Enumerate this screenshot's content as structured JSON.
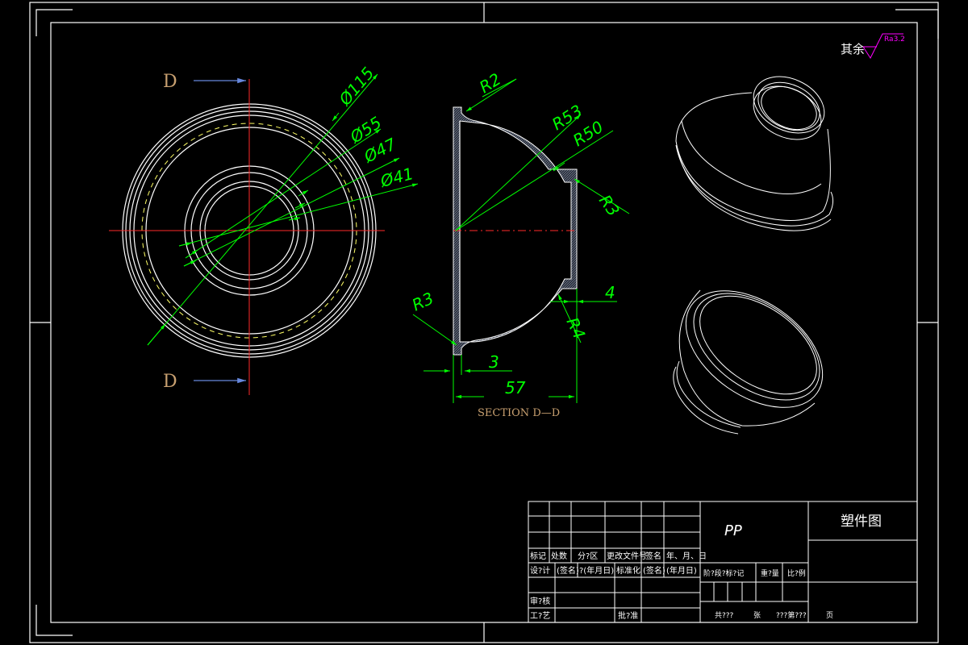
{
  "drawing": {
    "section_marker": "D",
    "section_title": "SECTION D—D",
    "roughness": {
      "text": "其余",
      "value": "Ra3.2"
    },
    "front_view_dims": [
      "Ø115",
      "Ø55",
      "Ø47",
      "Ø41"
    ],
    "section_dims": [
      "R2",
      "R53",
      "R50",
      "R3",
      "R3",
      "R4",
      "4",
      "3",
      "57"
    ]
  },
  "title_block": {
    "material": "PP",
    "drawing_name": "塑件图",
    "row_headers": [
      "标记",
      "处数",
      "分?区",
      "更改文件号",
      "签名",
      "年、月、日"
    ],
    "row_design": [
      "设?计",
      "(签名)",
      "?(年月日)",
      "标准化",
      "(签名)",
      "(年月日)"
    ],
    "row_review": "审?核",
    "row_process": "工?艺",
    "approve": "批?准",
    "stage_label": "阶?段?标?记",
    "weight_label": "重?量",
    "scale_label": "比?例",
    "sheet_total": "共???",
    "sheet_label": "张",
    "sheet_no": "???第???",
    "page_label": "页"
  },
  "colors": {
    "background": "#000000",
    "lines": "#ffffff",
    "dimensions": "#00ff00",
    "center_lines": "#ff2a2a",
    "hidden": "#ffff66",
    "section_label": "#c8a070",
    "roughness": "#ff00ff"
  }
}
